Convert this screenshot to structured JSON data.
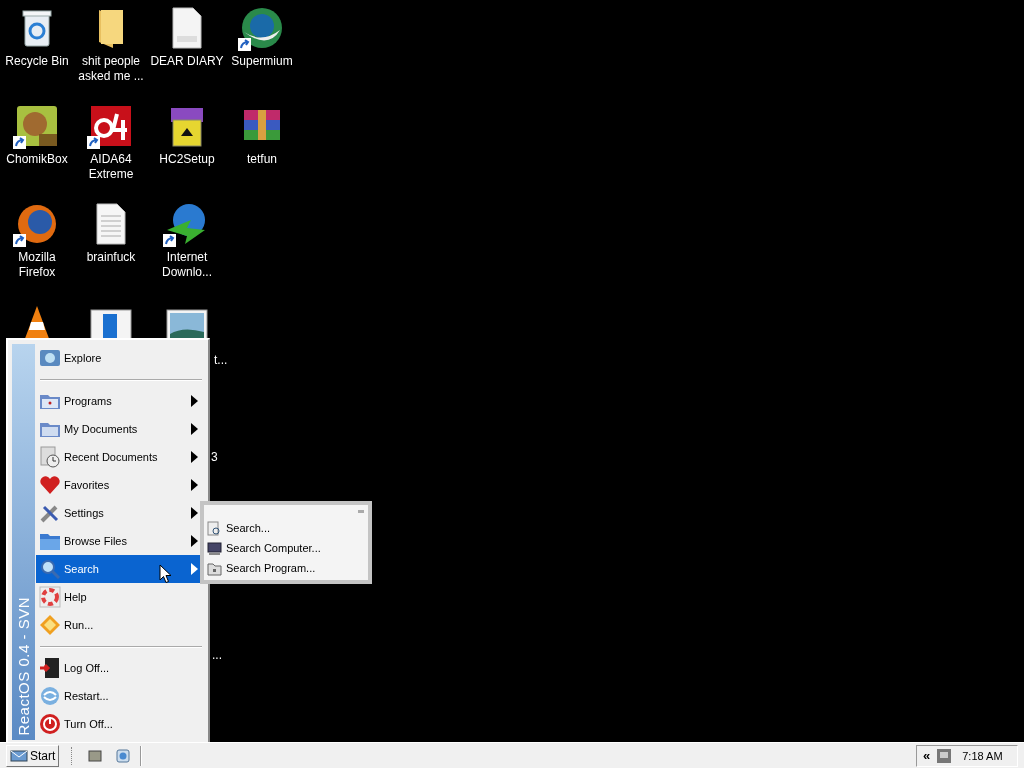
{
  "desktop": {
    "icons": [
      {
        "label": "Recycle Bin",
        "shortcut": false
      },
      {
        "label": "shit people asked me ...",
        "shortcut": false
      },
      {
        "label": "DEAR DIARY",
        "shortcut": false
      },
      {
        "label": "Supermium",
        "shortcut": true
      },
      {
        "label": "ChomikBox",
        "shortcut": true
      },
      {
        "label": "AIDA64 Extreme",
        "shortcut": true
      },
      {
        "label": "HC2Setup",
        "shortcut": false
      },
      {
        "label": "tetfun",
        "shortcut": false
      },
      {
        "label": "Mozilla Firefox",
        "shortcut": true
      },
      {
        "label": "brainfuck",
        "shortcut": false
      },
      {
        "label": "Internet Downlo...",
        "shortcut": true
      }
    ],
    "partial_labels": [
      "t...",
      "3",
      "..."
    ]
  },
  "start_menu": {
    "banner": "ReactOS 0.4 - SVN",
    "sections": [
      {
        "items": [
          {
            "label": "Explore",
            "submenu": false,
            "selected": false
          }
        ]
      },
      {
        "items": [
          {
            "label": "Programs",
            "submenu": true,
            "selected": false
          },
          {
            "label": "My Documents",
            "submenu": true,
            "selected": false
          },
          {
            "label": "Recent Documents",
            "submenu": true,
            "selected": false
          },
          {
            "label": "Favorites",
            "submenu": true,
            "selected": false
          },
          {
            "label": "Settings",
            "submenu": true,
            "selected": false
          },
          {
            "label": "Browse Files",
            "submenu": true,
            "selected": false
          },
          {
            "label": "Search",
            "submenu": true,
            "selected": true
          },
          {
            "label": "Help",
            "submenu": false,
            "selected": false
          },
          {
            "label": "Run...",
            "submenu": false,
            "selected": false
          }
        ]
      },
      {
        "items": [
          {
            "label": "Log Off...",
            "submenu": false,
            "selected": false
          },
          {
            "label": "Restart...",
            "submenu": false,
            "selected": false
          },
          {
            "label": "Turn Off...",
            "submenu": false,
            "selected": false
          }
        ]
      }
    ]
  },
  "submenu": {
    "items": [
      {
        "label": "Search..."
      },
      {
        "label": "Search Computer..."
      },
      {
        "label": "Search Program..."
      }
    ]
  },
  "taskbar": {
    "start_button": "Start",
    "tray": {
      "expand": "«",
      "clock": "7:18 AM"
    }
  }
}
